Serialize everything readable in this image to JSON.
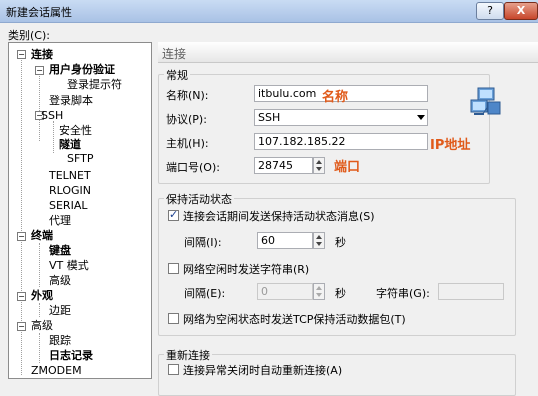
{
  "window": {
    "title": "新建会话属性",
    "help_label": "?",
    "close_label": "X"
  },
  "category_label": "类别(C):",
  "tree": {
    "connection": "连接",
    "user_auth": "用户身份验证",
    "login_prompt": "登录提示符",
    "login_script": "登录脚本",
    "ssh": "SSH",
    "security": "安全性",
    "tunnel": "隧道",
    "sftp": "SFTP",
    "telnet": "TELNET",
    "rlogin": "RLOGIN",
    "serial": "SERIAL",
    "proxy": "代理",
    "terminal": "终端",
    "keyboard": "键盘",
    "vt_mode": "VT 模式",
    "advanced1": "高级",
    "appearance": "外观",
    "margin": "边距",
    "advanced2": "高级",
    "trace": "跟踪",
    "log": "日志记录",
    "zmodem": "ZMODEM"
  },
  "header": "连接",
  "general": {
    "title": "常规",
    "name_label": "名称(N):",
    "name_value": "itbulu.com",
    "protocol_label": "协议(P):",
    "protocol_value": "SSH",
    "host_label": "主机(H):",
    "host_value": "107.182.185.22",
    "port_label": "端口号(O):",
    "port_value": "28745"
  },
  "annotations": {
    "name": "名称",
    "ip": "IP地址",
    "port": "端口"
  },
  "keepalive": {
    "title": "保持活动状态",
    "send_keepalive_label": "连接会话期间发送保持活动状态消息(S)",
    "send_keepalive_checked": true,
    "interval1_label": "间隔(I):",
    "interval1_value": "60",
    "sec1": "秒",
    "send_string_label": "网络空闲时发送字符串(R)",
    "send_string_checked": false,
    "interval2_label": "间隔(E):",
    "interval2_value": "0",
    "sec2": "秒",
    "string_label": "字符串(G):",
    "string_value": "",
    "tcp_keepalive_label": "网络为空闲状态时发送TCP保持活动数据包(T)",
    "tcp_keepalive_checked": false
  },
  "reconnect": {
    "title": "重新连接",
    "auto_reconnect_label": "连接异常关闭时自动重新连接(A)"
  },
  "colors": {
    "annotation": "#e05a1a",
    "check": "#1a3f8f"
  }
}
